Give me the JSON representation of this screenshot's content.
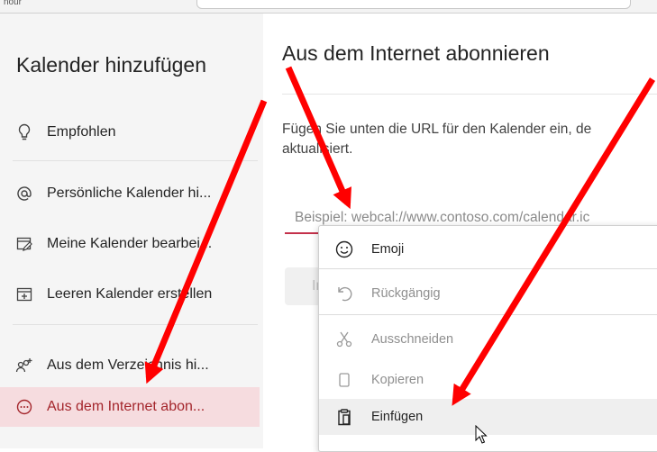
{
  "window": {
    "fragment_text": "nour"
  },
  "left_panel": {
    "title": "Kalender hinzufügen",
    "items": [
      {
        "label": "Empfohlen",
        "icon": "lightbulb-icon"
      },
      {
        "label": "Persönliche Kalender hi...",
        "icon": "at-sign-icon"
      },
      {
        "label": "Meine Kalender bearbei...",
        "icon": "edit-calendar-icon"
      },
      {
        "label": "Leeren Kalender erstellen",
        "icon": "calendar-add-icon"
      },
      {
        "label": "Aus dem Verzeichnis hi...",
        "icon": "people-add-icon"
      },
      {
        "label": "Aus dem Internet abon...",
        "icon": "more-circle-icon",
        "selected": true
      }
    ]
  },
  "main": {
    "title": "Aus dem Internet abonnieren",
    "description_line1": "Fügen Sie unten die URL für den Kalender ein, de",
    "description_line2": "aktualisiert.",
    "url_input": {
      "value": "",
      "placeholder": "Beispiel: webcal://www.contoso.com/calendar.ic"
    },
    "import_button_label": "Im"
  },
  "context_menu": {
    "items": [
      {
        "label": "Emoji",
        "icon": "emoji-icon",
        "enabled": true
      },
      {
        "label": "Rückgängig",
        "icon": "undo-icon",
        "enabled": false
      },
      {
        "label": "Ausschneiden",
        "icon": "cut-icon",
        "enabled": false
      },
      {
        "label": "Kopieren",
        "icon": "copy-icon",
        "enabled": false
      },
      {
        "label": "Einfügen",
        "icon": "paste-icon",
        "enabled": true,
        "hovered": true
      }
    ]
  },
  "colors": {
    "accent": "#c4314b",
    "selected_bg": "#f6dcdf",
    "selected_text": "#a4262c",
    "annotation_arrow": "#ff0000"
  }
}
